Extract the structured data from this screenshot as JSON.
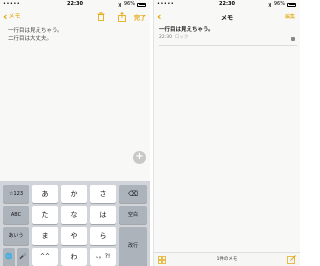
{
  "left": {
    "status": {
      "carrier": "•••••",
      "time": "22:30",
      "battery": "96%",
      "battery_level": 0.96
    },
    "nav": {
      "back_label": "メモ",
      "done_label": "完了"
    },
    "note": {
      "line1": "一行目は見えちゃう。",
      "line2": "二行目は大丈夫。"
    },
    "add_button": "+",
    "keyboard": {
      "row1": [
        "☆123",
        "あ",
        "か",
        "さ",
        "⌫"
      ],
      "row2": [
        "ABC",
        "た",
        "な",
        "は",
        "空白"
      ],
      "row3": [
        "あいう",
        "ま",
        "や",
        "ら",
        "改行"
      ],
      "row4": [
        "🌐",
        "🎤",
        "^^",
        "わ",
        "、。?!"
      ]
    }
  },
  "right": {
    "status": {
      "carrier": "•••••",
      "time": "22:30",
      "battery": "96%",
      "battery_level": 0.96
    },
    "nav": {
      "title": "メモ",
      "edit_label": "編集"
    },
    "list": [
      {
        "title": "一行目は見えちゃう。",
        "time": "22:30",
        "status": "ロック"
      }
    ],
    "toolbar": {
      "count": "1件のメモ"
    }
  },
  "colors": {
    "accent": "#e2a300",
    "keyboard_bg": "#d1d4d9",
    "key": "#ffffff",
    "key_gray": "#adb3bb"
  },
  "icons": [
    "chevron-left-icon",
    "share-icon",
    "trash-icon",
    "wifi-icon",
    "bluetooth-icon",
    "battery-icon",
    "plus-icon",
    "globe-icon",
    "microphone-icon",
    "backspace-icon",
    "lock-icon",
    "grid-icon",
    "compose-icon"
  ]
}
